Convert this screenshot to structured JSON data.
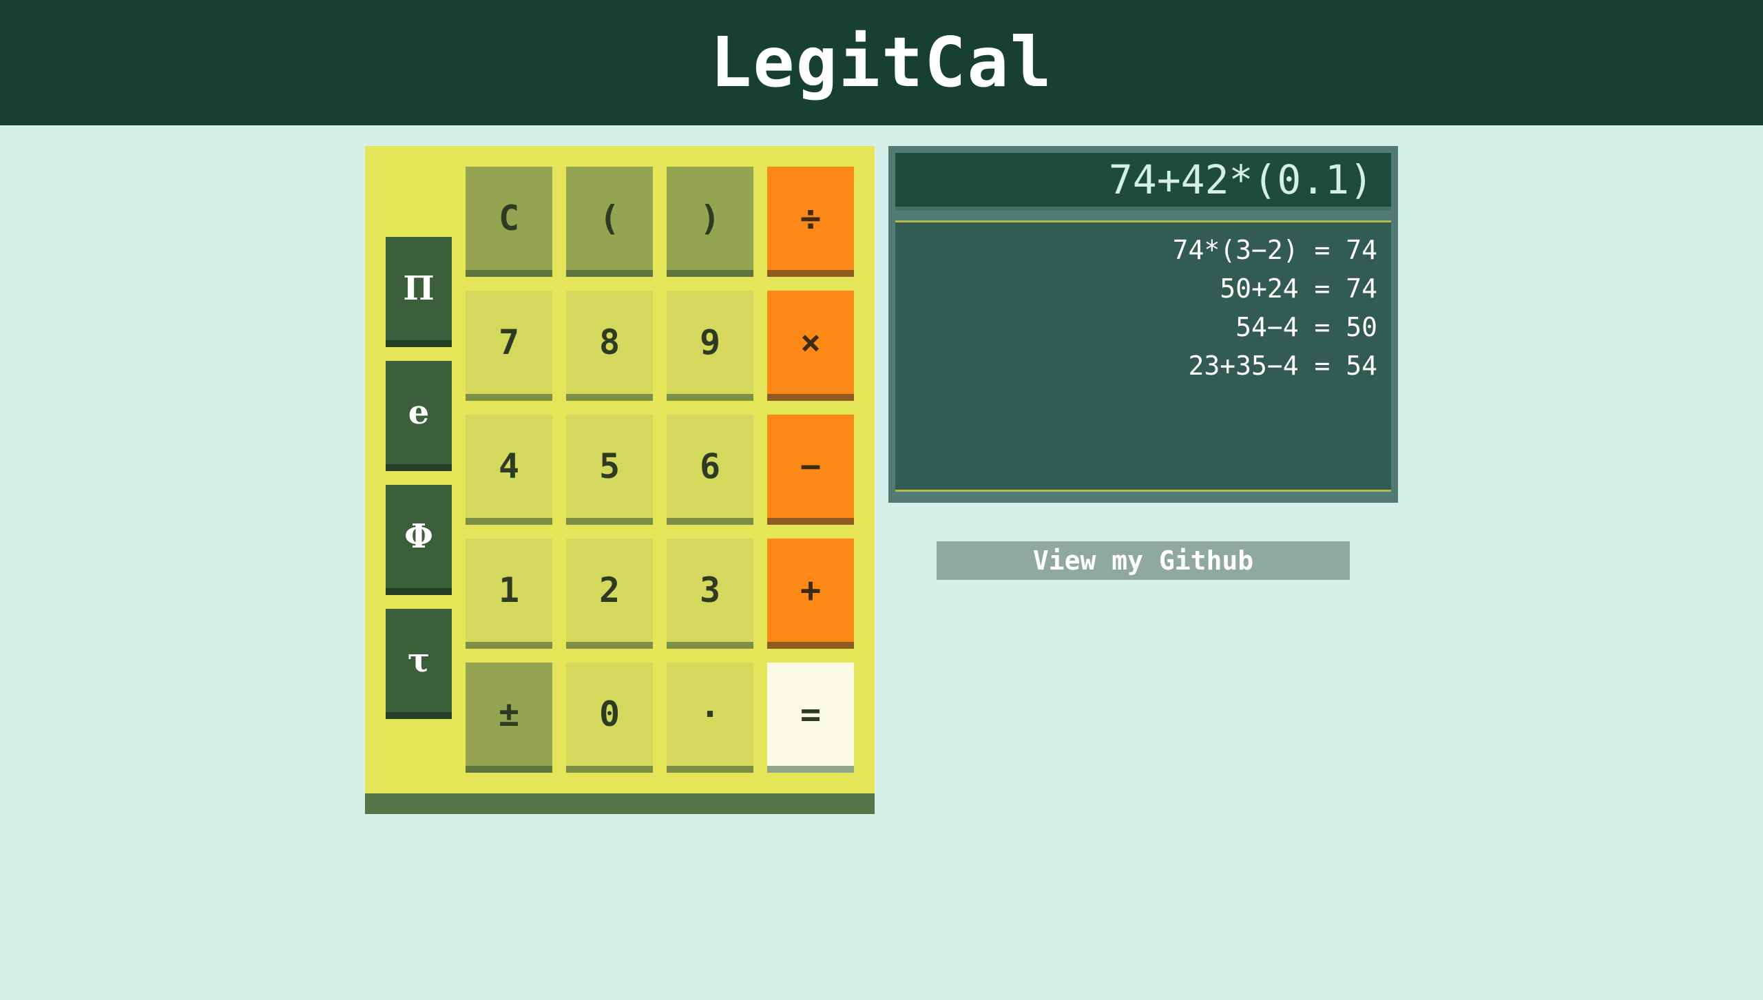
{
  "header": {
    "title": "LegitCal"
  },
  "constants": [
    {
      "name": "pi",
      "label": "Π"
    },
    {
      "name": "e",
      "label": "e"
    },
    {
      "name": "phi",
      "label": "Φ"
    },
    {
      "name": "tau",
      "label": "τ"
    }
  ],
  "keypad": {
    "clear": "C",
    "open_paren": "(",
    "close_paren": ")",
    "divide": "÷",
    "seven": "7",
    "eight": "8",
    "nine": "9",
    "multiply": "×",
    "four": "4",
    "five": "5",
    "six": "6",
    "subtract": "−",
    "one": "1",
    "two": "2",
    "three": "3",
    "add": "+",
    "plus_minus": "±",
    "zero": "0",
    "decimal": "·",
    "equals": "="
  },
  "display": {
    "current": "74+42*(0.1)",
    "history": [
      "74*(3−2) = 74",
      "50+24 = 74",
      "54−4 = 50",
      "23+35−4 = 54"
    ]
  },
  "github_button": {
    "label": "View my Github"
  },
  "colors": {
    "header": "#183f34",
    "background": "#d6f0e9",
    "calc_body": "#e5e55a",
    "number_key": "#d4d95d",
    "function_key": "#94a450",
    "operator_key": "#fb8817",
    "equals_key": "#fcfbe6",
    "constant_key": "#3c5f3b",
    "display": "#325b51"
  }
}
